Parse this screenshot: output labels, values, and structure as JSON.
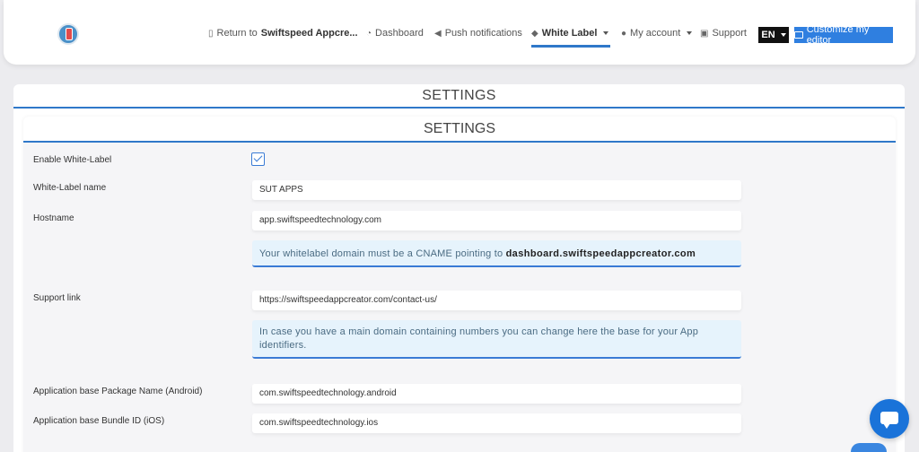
{
  "nav": {
    "return_prefix": "Return to",
    "return_app": "Swiftspeed Appcre...",
    "dashboard": "Dashboard",
    "push": "Push notifications",
    "white_label": "White Label",
    "my_account": "My account",
    "support": "Support",
    "lang": "EN",
    "customize": "Customize my editor"
  },
  "page": {
    "outer_title": "SETTINGS",
    "inner_title": "SETTINGS"
  },
  "form": {
    "enable_label": "Enable White-Label",
    "enable_checked": true,
    "name_label": "White-Label name",
    "name_value": "SUT APPS",
    "hostname_label": "Hostname",
    "hostname_value": "app.swiftspeedtechnology.com",
    "hostname_alert_text": "Your whitelabel domain must be a CNAME pointing to",
    "hostname_alert_domain": "dashboard.swiftspeedappcreator.com",
    "support_label": "Support link",
    "support_value": "https://swiftspeedappcreator.com/contact-us/",
    "support_alert_text": "In case you have a main domain containing numbers you can change here the base for your App identifiers.",
    "android_label": "Application base Package Name (Android)",
    "android_value": "com.swiftspeedtechnology.android",
    "ios_label": "Application base Bundle ID (iOS)",
    "ios_value": "com.swiftspeedtechnology.ios"
  },
  "colors": {
    "accent": "#2f78c9",
    "customize_bg": "#2f7fe0",
    "alert_bg": "#e6f3fc"
  }
}
